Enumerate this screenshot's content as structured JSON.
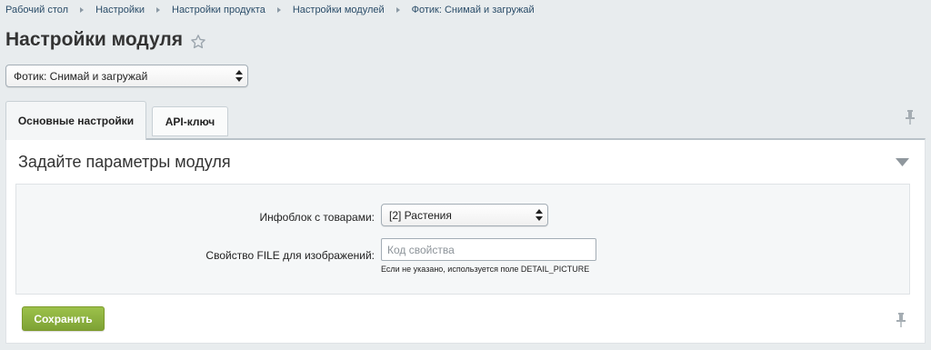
{
  "breadcrumb": [
    {
      "label": "Рабочий стол"
    },
    {
      "label": "Настройки"
    },
    {
      "label": "Настройки продукта"
    },
    {
      "label": "Настройки модулей"
    },
    {
      "label": "Фотик: Снимай и загружай"
    }
  ],
  "page": {
    "title": "Настройки модуля",
    "favorite_icon": "star-icon"
  },
  "module_select": {
    "value": "Фотик: Снимай и загружай"
  },
  "tabs": [
    {
      "label": "Основные настройки",
      "active": true
    },
    {
      "label": "API-ключ",
      "active": false
    }
  ],
  "panel": {
    "heading": "Задайте параметры модуля",
    "fields": {
      "iblock": {
        "label": "Инфоблок с товарами:",
        "value": "[2] Растения"
      },
      "file_property": {
        "label": "Свойство FILE для изображений:",
        "placeholder": "Код свойства",
        "value": "",
        "hint": "Если не указано, используется поле DETAIL_PICTURE"
      }
    },
    "save_label": "Сохранить"
  },
  "colors": {
    "background": "#e8ecee",
    "save_button": "#8db33f",
    "link": "#2b4d69"
  }
}
